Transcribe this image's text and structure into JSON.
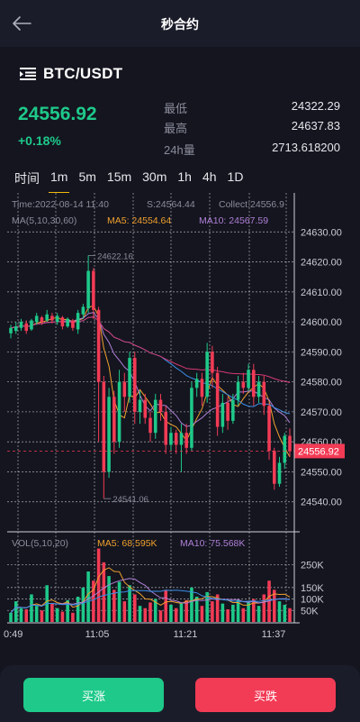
{
  "header": {
    "title": "秒合约",
    "back_icon": "arrow-left-icon"
  },
  "pair": {
    "icon": "list-indent-icon",
    "name": "BTC/USDT"
  },
  "ticker": {
    "price": "24556.92",
    "change": "+0.18%"
  },
  "stats": [
    {
      "label": "最低",
      "value": "24322.29"
    },
    {
      "label": "最高",
      "value": "24637.83"
    },
    {
      "label": "24h量",
      "value": "2713.618200"
    }
  ],
  "intervals": [
    "时间",
    "1m",
    "5m",
    "15m",
    "30m",
    "1h",
    "4h",
    "1D"
  ],
  "active_interval": "1m",
  "chart_info": {
    "time": "Time:2022-08-14 11:40",
    "s": "S:24564.44",
    "collect": "Collect:24556.9",
    "ma_title": "MA(5,10,30,60)",
    "ma5": "MA5: 24554.64",
    "ma10": "MA10: 24567.59",
    "vol_title": "VOL(5,10,20)",
    "vol_ma5": "MA5: 68.595K",
    "vol_ma10": "MA10: 75.568K",
    "high_mark": "24622.16",
    "low_mark": "24541.06",
    "current_price_tag": "24556.92"
  },
  "chart_data": {
    "type": "candlestick",
    "y_ticks": [
      "24630.00",
      "24620.00",
      "24610.00",
      "24600.00",
      "24590.00",
      "24580.00",
      "24570.00",
      "24560.00",
      "24550.00",
      "24540.00"
    ],
    "ylim": [
      24536,
      24634
    ],
    "vol_ticks": [
      "250K",
      "150K",
      "100K",
      "50K"
    ],
    "vol_max": 330,
    "x_ticks": [
      "10:49",
      "11:05",
      "11:21",
      "11:37"
    ],
    "candles": [
      {
        "o": 24596.2,
        "c": 24598.0,
        "h": 24599.0,
        "l": 24594.5,
        "v": 40
      },
      {
        "o": 24597.0,
        "c": 24598.5,
        "h": 24600.0,
        "l": 24596.0,
        "v": 90
      },
      {
        "o": 24598.0,
        "c": 24600.0,
        "h": 24601.0,
        "l": 24597.0,
        "v": 60
      },
      {
        "o": 24599.5,
        "c": 24597.0,
        "h": 24600.5,
        "l": 24596.0,
        "v": 55
      },
      {
        "o": 24597.5,
        "c": 24600.5,
        "h": 24601.0,
        "l": 24597.0,
        "v": 120
      },
      {
        "o": 24600.0,
        "c": 24602.0,
        "h": 24603.0,
        "l": 24599.0,
        "v": 70
      },
      {
        "o": 24601.5,
        "c": 24600.0,
        "h": 24602.0,
        "l": 24599.0,
        "v": 50
      },
      {
        "o": 24600.5,
        "c": 24602.5,
        "h": 24604.0,
        "l": 24600.0,
        "v": 160
      },
      {
        "o": 24602.0,
        "c": 24600.5,
        "h": 24603.0,
        "l": 24599.5,
        "v": 80
      },
      {
        "o": 24600.0,
        "c": 24602.0,
        "h": 24603.0,
        "l": 24599.0,
        "v": 60
      },
      {
        "o": 24601.5,
        "c": 24598.5,
        "h": 24602.0,
        "l": 24597.5,
        "v": 45
      },
      {
        "o": 24598.5,
        "c": 24601.0,
        "h": 24601.5,
        "l": 24598.0,
        "v": 95
      },
      {
        "o": 24600.5,
        "c": 24598.0,
        "h": 24601.0,
        "l": 24597.0,
        "v": 40
      },
      {
        "o": 24597.5,
        "c": 24603.0,
        "h": 24604.0,
        "l": 24596.0,
        "v": 110
      },
      {
        "o": 24602.5,
        "c": 24605.0,
        "h": 24606.0,
        "l": 24601.0,
        "v": 150
      },
      {
        "o": 24604.5,
        "c": 24617.0,
        "h": 24622.16,
        "l": 24603.0,
        "v": 220
      },
      {
        "o": 24617.0,
        "c": 24604.0,
        "h": 24618.0,
        "l": 24601.0,
        "v": 180
      },
      {
        "o": 24604.0,
        "c": 24580.0,
        "h": 24605.0,
        "l": 24560.0,
        "v": 320
      },
      {
        "o": 24580.0,
        "c": 24550.0,
        "h": 24582.0,
        "l": 24541.06,
        "v": 260
      },
      {
        "o": 24550.0,
        "c": 24575.0,
        "h": 24578.0,
        "l": 24548.0,
        "v": 200
      },
      {
        "o": 24575.0,
        "c": 24560.0,
        "h": 24577.0,
        "l": 24556.0,
        "v": 140
      },
      {
        "o": 24560.0,
        "c": 24580.0,
        "h": 24584.0,
        "l": 24558.0,
        "v": 175
      },
      {
        "o": 24580.0,
        "c": 24575.0,
        "h": 24583.0,
        "l": 24570.0,
        "v": 90
      },
      {
        "o": 24575.0,
        "c": 24588.0,
        "h": 24590.0,
        "l": 24573.0,
        "v": 160
      },
      {
        "o": 24588.0,
        "c": 24570.0,
        "h": 24590.0,
        "l": 24566.0,
        "v": 120
      },
      {
        "o": 24570.0,
        "c": 24574.0,
        "h": 24577.0,
        "l": 24566.0,
        "v": 70
      },
      {
        "o": 24574.0,
        "c": 24568.0,
        "h": 24576.0,
        "l": 24566.0,
        "v": 60
      },
      {
        "o": 24568.0,
        "c": 24563.0,
        "h": 24570.0,
        "l": 24560.0,
        "v": 85
      },
      {
        "o": 24563.0,
        "c": 24574.0,
        "h": 24576.0,
        "l": 24561.0,
        "v": 100
      },
      {
        "o": 24574.0,
        "c": 24570.0,
        "h": 24576.0,
        "l": 24567.0,
        "v": 50
      },
      {
        "o": 24570.0,
        "c": 24559.0,
        "h": 24572.0,
        "l": 24556.0,
        "v": 140
      },
      {
        "o": 24559.0,
        "c": 24563.0,
        "h": 24565.0,
        "l": 24557.0,
        "v": 75
      },
      {
        "o": 24563.0,
        "c": 24559.0,
        "h": 24564.0,
        "l": 24556.0,
        "v": 60
      },
      {
        "o": 24559.0,
        "c": 24563.0,
        "h": 24566.0,
        "l": 24550.0,
        "v": 80
      },
      {
        "o": 24563.0,
        "c": 24558.0,
        "h": 24566.0,
        "l": 24556.0,
        "v": 95
      },
      {
        "o": 24558.0,
        "c": 24578.0,
        "h": 24580.0,
        "l": 24557.0,
        "v": 150
      },
      {
        "o": 24578.0,
        "c": 24581.0,
        "h": 24583.0,
        "l": 24575.0,
        "v": 110
      },
      {
        "o": 24581.0,
        "c": 24575.0,
        "h": 24583.0,
        "l": 24572.0,
        "v": 70
      },
      {
        "o": 24575.0,
        "c": 24590.0,
        "h": 24593.0,
        "l": 24573.0,
        "v": 130
      },
      {
        "o": 24590.0,
        "c": 24583.0,
        "h": 24592.0,
        "l": 24578.0,
        "v": 90
      },
      {
        "o": 24583.0,
        "c": 24565.0,
        "h": 24585.0,
        "l": 24562.0,
        "v": 120
      },
      {
        "o": 24565.0,
        "c": 24573.0,
        "h": 24576.0,
        "l": 24563.0,
        "v": 80
      },
      {
        "o": 24573.0,
        "c": 24567.0,
        "h": 24575.0,
        "l": 24564.0,
        "v": 55
      },
      {
        "o": 24567.0,
        "c": 24574.0,
        "h": 24576.0,
        "l": 24566.0,
        "v": 75
      },
      {
        "o": 24574.0,
        "c": 24580.0,
        "h": 24582.0,
        "l": 24572.0,
        "v": 95
      },
      {
        "o": 24580.0,
        "c": 24578.0,
        "h": 24583.0,
        "l": 24576.0,
        "v": 60
      },
      {
        "o": 24578.0,
        "c": 24584.0,
        "h": 24586.0,
        "l": 24577.0,
        "v": 85
      },
      {
        "o": 24584.0,
        "c": 24575.0,
        "h": 24586.0,
        "l": 24572.0,
        "v": 100
      },
      {
        "o": 24575.0,
        "c": 24580.0,
        "h": 24582.0,
        "l": 24573.0,
        "v": 70
      },
      {
        "o": 24580.0,
        "c": 24572.0,
        "h": 24582.0,
        "l": 24569.0,
        "v": 120
      },
      {
        "o": 24572.0,
        "c": 24557.0,
        "h": 24573.0,
        "l": 24554.0,
        "v": 180
      },
      {
        "o": 24557.0,
        "c": 24546.0,
        "h": 24558.0,
        "l": 24544.0,
        "v": 140
      },
      {
        "o": 24546.0,
        "c": 24553.0,
        "h": 24555.0,
        "l": 24545.0,
        "v": 90
      },
      {
        "o": 24553.0,
        "c": 24562.0,
        "h": 24563.0,
        "l": 24551.0,
        "v": 75
      },
      {
        "o": 24562.0,
        "c": 24556.9,
        "h": 24564.44,
        "l": 24555.0,
        "v": 60
      }
    ],
    "ma_lines": [
      {
        "name": "MA5",
        "color": "#f0a02e"
      },
      {
        "name": "MA10",
        "color": "#b07fd6"
      },
      {
        "name": "MA30",
        "color": "#3a8ee6"
      },
      {
        "name": "MA60",
        "color": "#d63a73"
      }
    ],
    "current_price": 24556.92
  },
  "colors": {
    "up": "#1ec98a",
    "down": "#f23b55",
    "accent": "#f0b90b"
  },
  "buttons": {
    "buy": "买涨",
    "sell": "买跌"
  }
}
